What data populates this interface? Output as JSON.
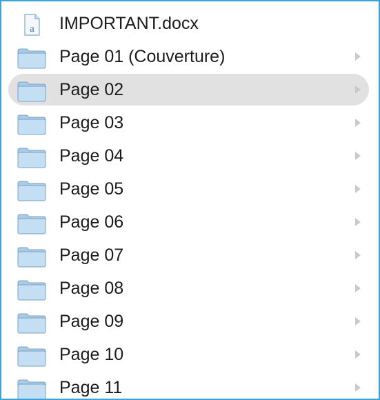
{
  "file_list": {
    "items": [
      {
        "label": "IMPORTANT.docx",
        "icon": "word-document-icon",
        "kind": "file",
        "selected": false
      },
      {
        "label": "Page 01 (Couverture)",
        "icon": "folder-icon",
        "kind": "folder",
        "selected": false
      },
      {
        "label": "Page 02",
        "icon": "folder-icon",
        "kind": "folder",
        "selected": true
      },
      {
        "label": "Page 03",
        "icon": "folder-icon",
        "kind": "folder",
        "selected": false
      },
      {
        "label": "Page 04",
        "icon": "folder-icon",
        "kind": "folder",
        "selected": false
      },
      {
        "label": "Page 05",
        "icon": "folder-icon",
        "kind": "folder",
        "selected": false
      },
      {
        "label": "Page 06",
        "icon": "folder-icon",
        "kind": "folder",
        "selected": false
      },
      {
        "label": "Page 07",
        "icon": "folder-icon",
        "kind": "folder",
        "selected": false
      },
      {
        "label": "Page 08",
        "icon": "folder-icon",
        "kind": "folder",
        "selected": false
      },
      {
        "label": "Page 09",
        "icon": "folder-icon",
        "kind": "folder",
        "selected": false
      },
      {
        "label": "Page 10",
        "icon": "folder-icon",
        "kind": "folder",
        "selected": false
      },
      {
        "label": "Page 11",
        "icon": "folder-icon",
        "kind": "folder",
        "selected": false
      }
    ]
  },
  "colors": {
    "border": "#3aa3dd",
    "selection": "#e1e1e1",
    "folder_fill": "#b9d7ef",
    "chevron": "#c9c9c9"
  }
}
